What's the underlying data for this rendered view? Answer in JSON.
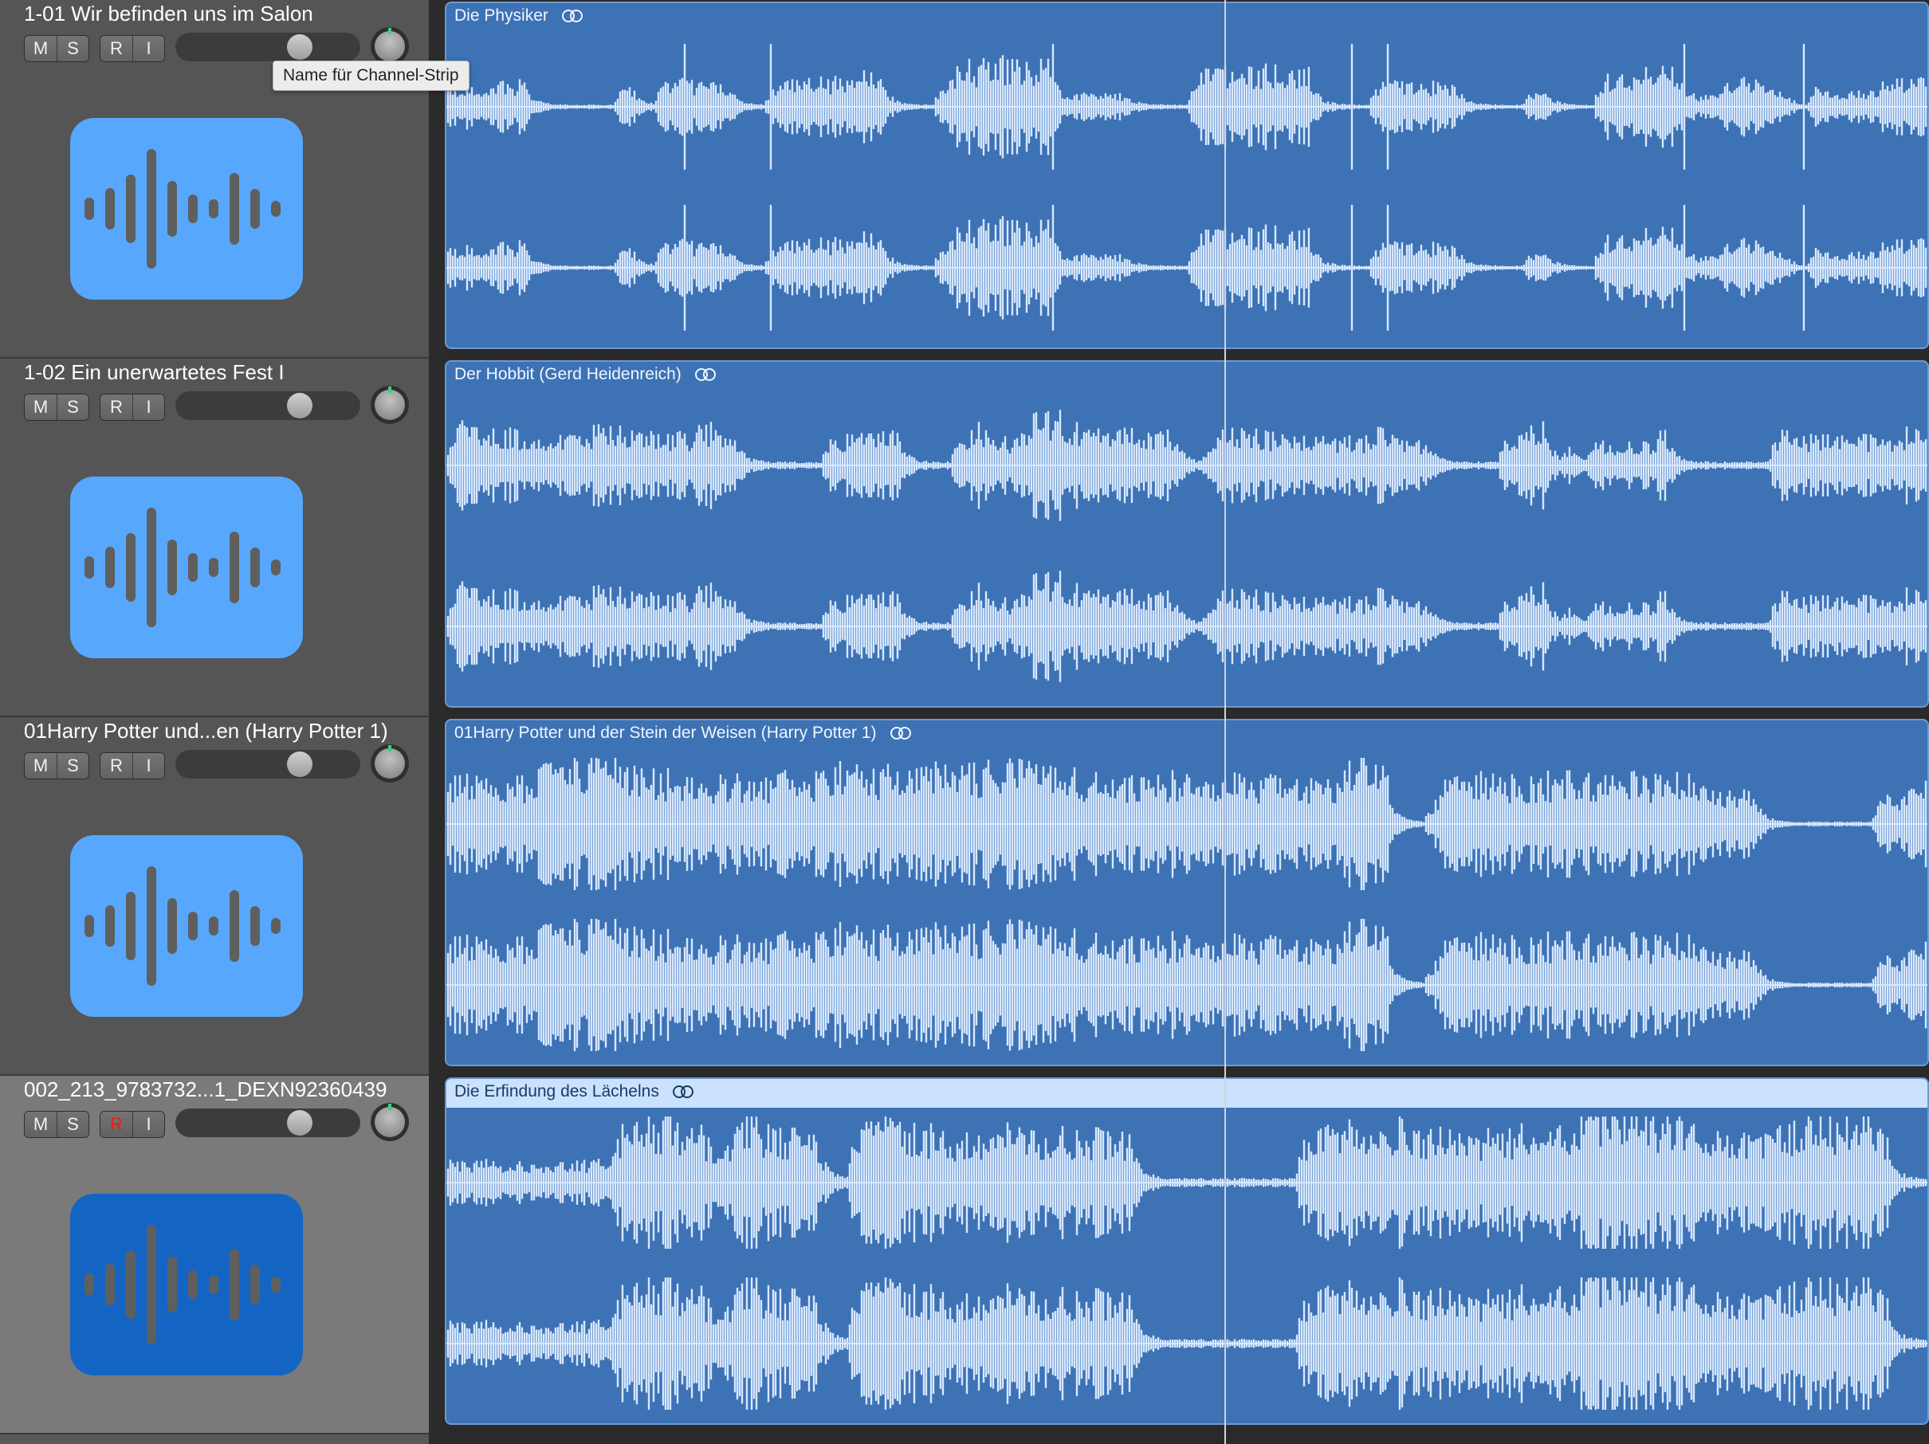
{
  "colors": {
    "region_fill": "#3d72b5",
    "waveform": "#d8e8ff",
    "track_icon": "#57a8fd",
    "track_icon_selected": "#1465c3",
    "record_armed": "#e02020",
    "selected_region_header": "#cbe2ff"
  },
  "tooltip": "Name für Channel-Strip",
  "tracks": [
    {
      "name": "1-01 Wir befinden uns im Salon",
      "buttons": [
        "M",
        "S",
        "R",
        "I"
      ],
      "volume": 0.7,
      "record_armed": false,
      "selected": false,
      "icon": "waveform-icon",
      "region": {
        "title": "Die Physiker",
        "icon": "loop-icon",
        "style": "sparse"
      }
    },
    {
      "name": "1-02 Ein unerwartetes Fest I",
      "buttons": [
        "M",
        "S",
        "R",
        "I"
      ],
      "volume": 0.7,
      "record_armed": false,
      "selected": false,
      "icon": "waveform-icon",
      "region": {
        "title": "Der Hobbit (Gerd Heidenreich)",
        "icon": "loop-icon",
        "style": "dense"
      }
    },
    {
      "name": "01Harry Potter und...en (Harry Potter 1)",
      "buttons": [
        "M",
        "S",
        "R",
        "I"
      ],
      "volume": 0.7,
      "record_armed": false,
      "selected": false,
      "icon": "waveform-icon",
      "region": {
        "title": "01Harry Potter und der Stein der Weisen (Harry Potter 1)",
        "icon": "loop-icon",
        "style": "music"
      }
    },
    {
      "name": "002_213_9783732...1_DEXN92360439",
      "buttons": [
        "M",
        "S",
        "R",
        "I"
      ],
      "volume": 0.7,
      "record_armed": true,
      "selected": true,
      "icon": "waveform-icon",
      "region": {
        "title": "Die Erfindung des Lächelns",
        "icon": "loop-icon",
        "style": "loud"
      }
    }
  ]
}
